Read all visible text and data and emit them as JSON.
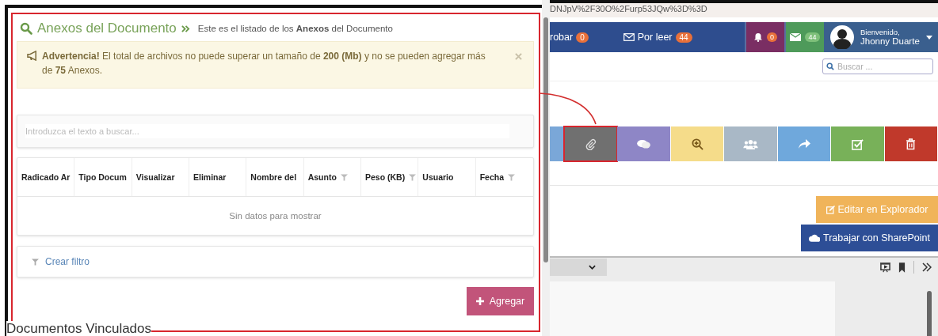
{
  "address_bar": {
    "url": "DNJpV%2F30O%2Furp53JQw%3D%3D"
  },
  "top_nav": [
    {
      "label": "robar",
      "count": "0",
      "kind": "text"
    },
    {
      "label": "Por leer",
      "count": "44",
      "kind": "mail"
    }
  ],
  "alerts": [
    {
      "kind": "bell",
      "count": "0",
      "color": "#7a2e63"
    },
    {
      "kind": "mail",
      "count": "44",
      "color": "#4e9a5a"
    }
  ],
  "user": {
    "greeting": "Bienvenido,",
    "name": "Jhonny Duarte"
  },
  "search": {
    "placeholder": "Buscar ..."
  },
  "actions": [
    {
      "kind": "paperclip",
      "color": "#707070",
      "highlighted": true
    },
    {
      "kind": "chat",
      "color": "#8e86c6",
      "highlighted": false
    },
    {
      "kind": "zoom",
      "color": "#f5dc8a",
      "highlighted": false
    },
    {
      "kind": "users",
      "color": "#a9b8c6",
      "highlighted": false
    },
    {
      "kind": "share",
      "color": "#6fa8dc",
      "highlighted": false
    },
    {
      "kind": "check",
      "color": "#78b159",
      "highlighted": false
    },
    {
      "kind": "trash",
      "color": "#c0392b",
      "highlighted": false
    }
  ],
  "editor_buttons": [
    {
      "label": "Editar en Explorador",
      "kind": "edit"
    },
    {
      "label": "Trabajar con SharePoint",
      "kind": "cloud"
    }
  ],
  "modal": {
    "title": "Anexos del Documento",
    "subtitle": "Este es el listado de los **Anexos** del Documento",
    "alert": "**Advertencia!** El total de archivos no puede superar un tamaño de **200 (Mb)** y no se pueden agregar más de **75** Anexos.",
    "search_placeholder": "Introduzca el texto a buscar...",
    "columns": [
      {
        "label": "Radicado Ar",
        "filter": false
      },
      {
        "label": "Tipo Docum",
        "filter": false
      },
      {
        "label": "Visualizar",
        "filter": false
      },
      {
        "label": "Eliminar",
        "filter": false
      },
      {
        "label": "Nombre del",
        "filter": false
      },
      {
        "label": "Asunto",
        "filter": true
      },
      {
        "label": "Peso (KB)",
        "filter": true
      },
      {
        "label": "Usuario",
        "filter": false
      },
      {
        "label": "Fecha",
        "filter": true
      }
    ],
    "empty_text": "Sin datos para mostrar",
    "filter_link": "Crear filtro",
    "add_button": "Agregar"
  },
  "section_heading": "Documentos Vinculados"
}
